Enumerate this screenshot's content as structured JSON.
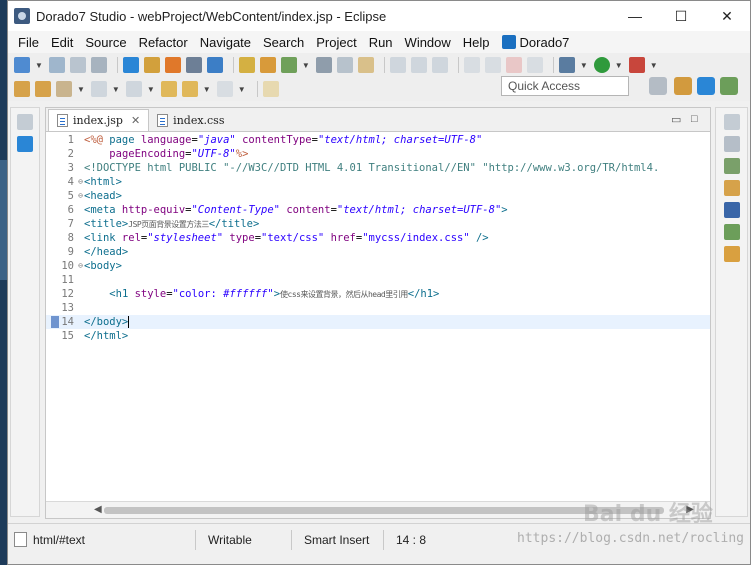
{
  "window": {
    "title": "Dorado7 Studio - webProject/WebContent/index.jsp - Eclipse",
    "minimize": "—",
    "maximize": "☐",
    "close": "✕"
  },
  "menu": [
    "File",
    "Edit",
    "Source",
    "Refactor",
    "Navigate",
    "Search",
    "Project",
    "Run",
    "Window",
    "Help",
    "Dorado7"
  ],
  "quick_access_placeholder": "Quick Access",
  "tabs": [
    {
      "label": "index.jsp",
      "close": "✕",
      "active": true
    },
    {
      "label": "index.css",
      "active": false
    }
  ],
  "tab_controls": {
    "minimize": "▭",
    "maximize": "□"
  },
  "code_lines": [
    {
      "n": "1",
      "fold": ""
    },
    {
      "n": "2",
      "fold": ""
    },
    {
      "n": "3",
      "fold": ""
    },
    {
      "n": "4",
      "fold": "⊖"
    },
    {
      "n": "5",
      "fold": "⊖"
    },
    {
      "n": "6",
      "fold": ""
    },
    {
      "n": "7",
      "fold": ""
    },
    {
      "n": "8",
      "fold": ""
    },
    {
      "n": "9",
      "fold": ""
    },
    {
      "n": "10",
      "fold": "⊖"
    },
    {
      "n": "11",
      "fold": ""
    },
    {
      "n": "12",
      "fold": ""
    },
    {
      "n": "13",
      "fold": ""
    },
    {
      "n": "14",
      "fold": ""
    },
    {
      "n": "15",
      "fold": ""
    }
  ],
  "code": {
    "l1": {
      "open": "<%@",
      "kw": " page ",
      "a1": "language",
      "v1": "\"java\"",
      "a2": " contentType",
      "v2": "\"text/html; charset=UTF-8\""
    },
    "l2": {
      "indent": "    ",
      "a": "pageEncoding",
      "v": "\"UTF-8\"",
      "close": "%>"
    },
    "l3": "<!DOCTYPE html PUBLIC \"-//W3C//DTD HTML 4.01 Transitional//EN\" \"http://www.w3.org/TR/html4.",
    "l4": "<html>",
    "l5": "<head>",
    "l6": {
      "tag": "<meta",
      "a1": " http-equiv",
      "v1": "\"Content-Type\"",
      "a2": " content",
      "v2": "\"text/html; charset=UTF-8\"",
      "end": ">"
    },
    "l7": {
      "open": "<title>",
      "text": "JSP页面背景设置方法三",
      "close": "</title>"
    },
    "l8": {
      "tag": "<link",
      "a1": " rel",
      "v1": "\"stylesheet\"",
      "a2": " type",
      "v2": "\"text/css\"",
      "a3": " href",
      "v3": "\"mycss/index.css\"",
      "end": " />"
    },
    "l9": "</head>",
    "l10": "<body>",
    "l12": {
      "indent": "    ",
      "tag": "<h1",
      "a": " style",
      "eq": "=",
      "q1": "\"color: ",
      "v": "#ffffff",
      "q2": "\"",
      "gt": ">",
      "text": "使css来设置背景，然后从head里引用",
      "close": "</h1>"
    },
    "l14": {
      "tag": "</body>"
    },
    "l15": "</html>"
  },
  "status": {
    "path": "html/#text",
    "writable": "Writable",
    "insert_mode": "Smart Insert",
    "position": "14 : 8"
  },
  "watermarks": {
    "baidu": "Bai du 经验",
    "csdn": "https://blog.csdn.net/rocling"
  }
}
